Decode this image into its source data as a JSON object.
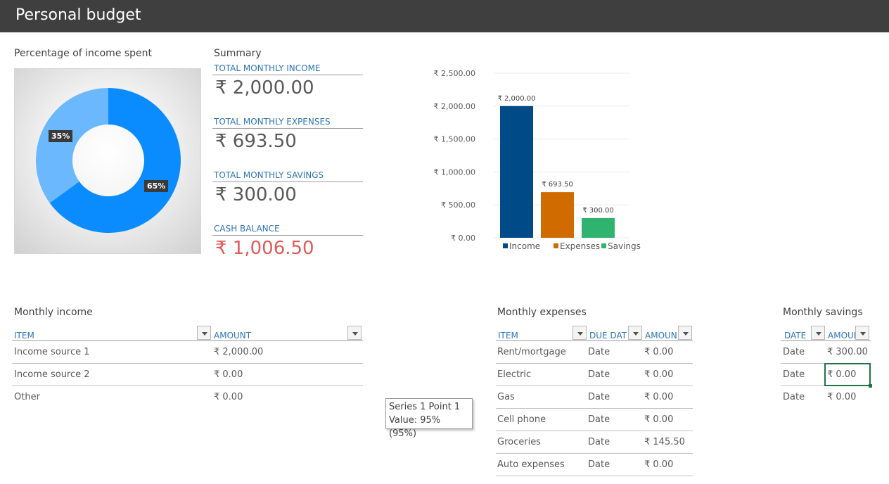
{
  "header": {
    "title": "Personal budget"
  },
  "donut": {
    "label": "Percentage of income spent",
    "spent_pct_label": "35%",
    "remaining_pct_label": "65%",
    "spent_fraction": 0.35,
    "colors": {
      "spent": "#6bb8ff",
      "remaining": "#0a8cff"
    }
  },
  "summary": {
    "label": "Summary",
    "items": [
      {
        "label": "TOTAL MONTHLY INCOME",
        "value": "₹ 2,000.00"
      },
      {
        "label": "TOTAL MONTHLY EXPENSES",
        "value": "₹ 693.50"
      },
      {
        "label": "TOTAL MONTHLY SAVINGS",
        "value": "₹ 300.00"
      },
      {
        "label": "CASH BALANCE",
        "value": "₹ 1,006.50"
      }
    ]
  },
  "chart_data": {
    "type": "bar",
    "categories": [
      "Income",
      "Expenses",
      "Savings"
    ],
    "values": [
      2000,
      693.5,
      300
    ],
    "data_labels": [
      "₹ 2,000.00",
      "₹ 693.50",
      "₹ 300.00"
    ],
    "yticks": [
      "₹ 0.00",
      "₹ 500.00",
      "₹ 1,000.00",
      "₹ 1,500.00",
      "₹ 2,000.00",
      "₹ 2,500.00"
    ],
    "ylim": [
      0,
      2500
    ],
    "colors": [
      "#004a87",
      "#d06b00",
      "#2fb36f"
    ],
    "legend": [
      "Income",
      "Expenses",
      "Savings"
    ],
    "legend_position": "bottom",
    "grid": true
  },
  "income": {
    "label": "Monthly income",
    "headers": [
      "ITEM",
      "AMOUNT"
    ],
    "rows": [
      [
        "Income source 1",
        "₹ 2,000.00"
      ],
      [
        "Income source 2",
        "₹ 0.00"
      ],
      [
        "Other",
        "₹ 0.00"
      ]
    ]
  },
  "expenses": {
    "label": "Monthly expenses",
    "headers": [
      "ITEM",
      "DUE DATE",
      "AMOUNT"
    ],
    "rows": [
      [
        "Rent/mortgage",
        "Date",
        "₹ 0.00"
      ],
      [
        "Electric",
        "Date",
        "₹ 0.00"
      ],
      [
        "Gas",
        "Date",
        "₹ 0.00"
      ],
      [
        "Cell phone",
        "Date",
        "₹ 0.00"
      ],
      [
        "Groceries",
        "Date",
        "₹ 145.50"
      ],
      [
        "Auto expenses",
        "Date",
        "₹ 0.00"
      ]
    ]
  },
  "savings": {
    "label": "Monthly savings",
    "headers": [
      "DATE",
      "AMOUNT"
    ],
    "rows": [
      [
        "Date",
        "₹ 300.00"
      ],
      [
        "Date",
        "₹ 0.00"
      ],
      [
        "Date",
        "₹ 0.00"
      ]
    ]
  },
  "tooltip": {
    "line1": "Series 1 Point 1",
    "line2": "Value: 95% (95%)"
  }
}
